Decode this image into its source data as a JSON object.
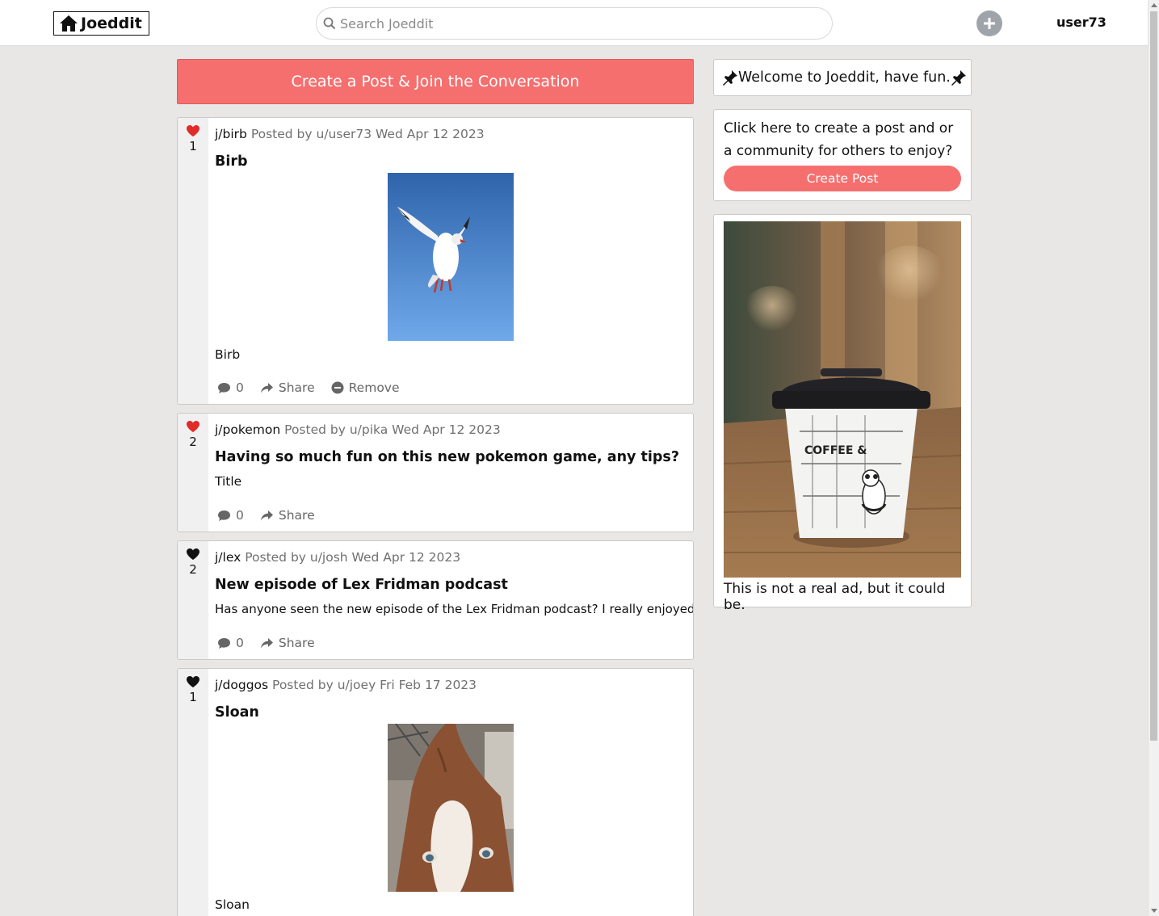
{
  "header": {
    "logo_text": "Joeddit",
    "search_placeholder": "Search Joeddit",
    "username": "user73"
  },
  "create_banner": "Create a Post & Join the Conversation",
  "posts": [
    {
      "liked": true,
      "votes": "1",
      "community": "j/birb",
      "posted_by": "Posted by u/user73 Wed Apr 12 2023",
      "title": "Birb",
      "text": "Birb",
      "comments": "0",
      "share_label": "Share",
      "remove_label": "Remove"
    },
    {
      "liked": true,
      "votes": "2",
      "community": "j/pokemon",
      "posted_by": "Posted by u/pika Wed Apr 12 2023",
      "title": "Having so much fun on this new pokemon game, any tips?",
      "text": "Title",
      "comments": "0",
      "share_label": "Share"
    },
    {
      "liked": false,
      "votes": "2",
      "community": "j/lex",
      "posted_by": "Posted by u/josh Wed Apr 12 2023",
      "title": "New episode of Lex Fridman podcast",
      "text": "Has anyone seen the new episode of the Lex Fridman podcast? I really enjoyed it.",
      "comments": "0",
      "share_label": "Share"
    },
    {
      "liked": false,
      "votes": "1",
      "community": "j/doggos",
      "posted_by": "Posted by u/joey Fri Feb 17 2023",
      "title": "Sloan",
      "text": "Sloan"
    }
  ],
  "sidebar": {
    "welcome": "Welcome to Joeddit, have fun.",
    "cta_text": "Click here to create a post and or a community for others to enjoy?",
    "cta_button": "Create Post",
    "ad_caption": "This is not a real ad, but it could be.",
    "ad_cup_text": "COFFEE &"
  },
  "colors": {
    "accent": "#f56f6f",
    "liked_heart": "#e02b2b",
    "background": "#e9e7e5"
  }
}
